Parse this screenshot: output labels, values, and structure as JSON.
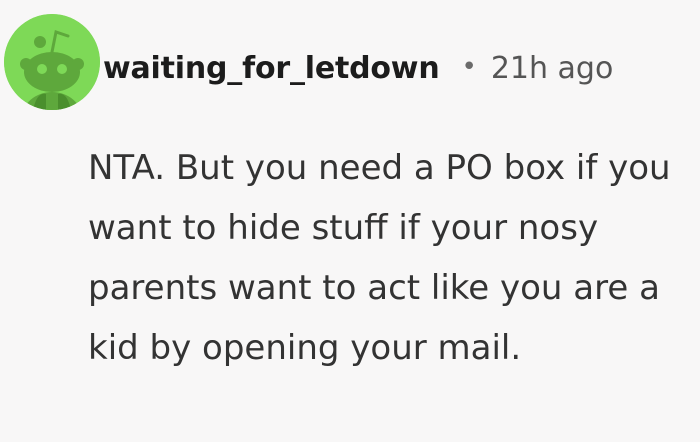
{
  "comment": {
    "author": "waiting_for_letdown",
    "separator": "•",
    "time_ago": "21h ago",
    "text": "NTA. But you need a PO box if you want to hide stuff if your nosy parents want to act like you are a kid by opening your mail."
  },
  "avatar": {
    "icon": "snoo-avatar-icon",
    "background_color": "#7ed957"
  }
}
